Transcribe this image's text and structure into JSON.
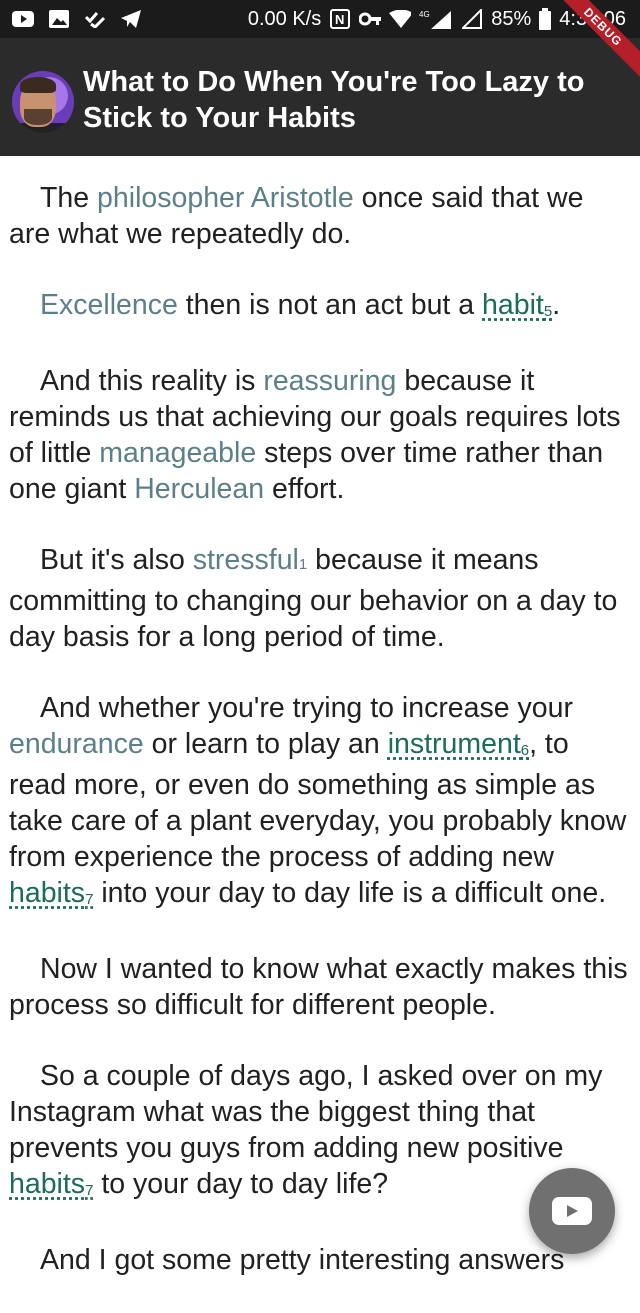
{
  "status_bar": {
    "speed": "0.00 K/s",
    "network_label": "4G",
    "battery": "85%",
    "time": "4:30:06"
  },
  "app_bar": {
    "title": "What to Do When You're Too Lazy to Stick to Your Habits",
    "debug_banner": "DEBUG"
  },
  "article": {
    "p1": {
      "a": "The ",
      "k1": "philosopher Aristotle",
      "b": " once said that we are what we repeatedly do."
    },
    "p2": {
      "k1": "Excellence",
      "a": " then is not an act but a ",
      "fn1": "habit",
      "fn1_num": "5",
      "b": "."
    },
    "p3": {
      "a": "And this reality is ",
      "k1": "reassuring",
      "b": " because it reminds us that achieving our goals requires lots of little ",
      "k2": "manageable",
      "c": " steps over time rather than one giant ",
      "k3": "Herculean",
      "d": " effort."
    },
    "p4": {
      "a": "But it's also ",
      "k1": "stressful",
      "k1_num": "1",
      "b": " because it means committing to changing our behavior on a day to day basis for a long period of time."
    },
    "p5": {
      "a": "And whether you're trying to increase your ",
      "k1": "endurance",
      "b": " or learn to play an ",
      "fn1": "instrument",
      "fn1_num": "6",
      "c": ", to read more, or even do something as simple as take care of a plant everyday, you probably know from experience the process of adding new ",
      "fn2": "habits",
      "fn2_num": "7",
      "d": " into your day to day life is a difficult one."
    },
    "p6": {
      "a": "Now I wanted to know what exactly makes this process so difficult for different people."
    },
    "p7": {
      "a": "So a couple of days ago, I asked over on my Instagram what was the biggest thing that prevents you guys from adding new positive ",
      "fn1": "habits",
      "fn1_num": "7",
      "b": " to your day to day life?"
    },
    "p8": {
      "a": "And I got some pretty interesting answers"
    }
  }
}
